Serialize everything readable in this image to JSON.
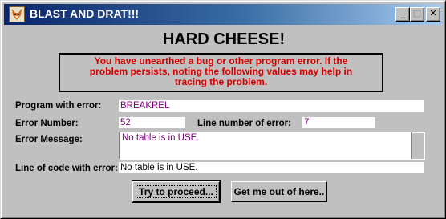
{
  "window": {
    "title": "BLAST AND DRAT!!!",
    "icons": {
      "app": "fox-icon",
      "minimize": "minimize-icon",
      "maximize": "maximize-icon",
      "close": "close-icon"
    },
    "minimize_glyph": "_",
    "maximize_glyph": "□",
    "close_glyph": "✕"
  },
  "heading": "HARD CHEESE!",
  "message": "You have unearthed a bug or other program error. If the problem persists, noting the following values may help in tracing the problem.",
  "fields": {
    "program_label": "Program with error:",
    "program_value": "BREAKREL",
    "error_number_label": "Error Number:",
    "error_number_value": "52",
    "line_number_label": "Line number of error:",
    "line_number_value": "7",
    "error_message_label": "Error Message:",
    "error_message_value": "No table is in USE.",
    "line_of_code_label": "Line of code with error:",
    "line_of_code_value": "No table is in USE."
  },
  "buttons": {
    "proceed": "Try to proceed...",
    "exit": "Get me out of here.."
  },
  "colors": {
    "message_text": "#d40000",
    "field_value": "#800080",
    "titlebar_start": "#0a246a",
    "face": "#c0c0c0"
  }
}
